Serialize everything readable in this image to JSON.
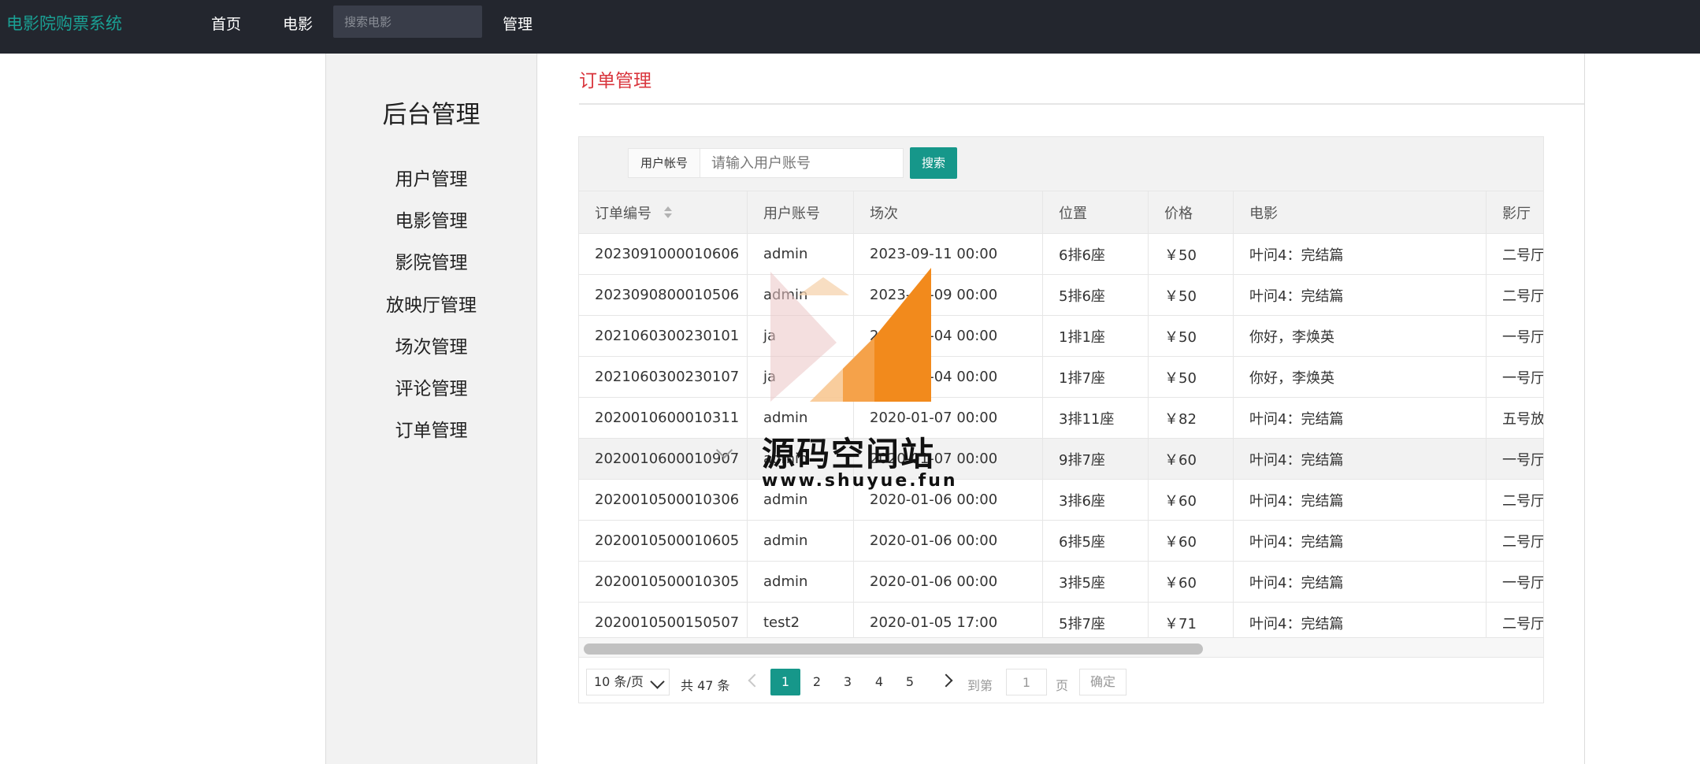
{
  "app": {
    "brand": "电影院购票系统"
  },
  "nav": {
    "home": "首页",
    "movies": "电影",
    "search_placeholder": "搜索电影",
    "admin": "管理"
  },
  "sidebar": {
    "title": "后台管理",
    "items": [
      {
        "label": "用户管理"
      },
      {
        "label": "电影管理"
      },
      {
        "label": "影院管理"
      },
      {
        "label": "放映厅管理"
      },
      {
        "label": "场次管理"
      },
      {
        "label": "评论管理"
      },
      {
        "label": "订单管理"
      }
    ]
  },
  "page": {
    "title": "订单管理"
  },
  "filter": {
    "label": "用户帐号",
    "placeholder": "请输入用户账号",
    "button": "搜索"
  },
  "table": {
    "headers": [
      "订单编号",
      "用户账号",
      "场次",
      "位置",
      "价格",
      "电影",
      "影厅"
    ],
    "rows": [
      [
        "2023091000010606",
        "admin",
        "2023-09-11 00:00",
        "6排6座",
        "￥50",
        "叶问4：完结篇",
        "二号厅"
      ],
      [
        "2023090800010506",
        "admin",
        "2023-09-09 00:00",
        "5排6座",
        "￥50",
        "叶问4：完结篇",
        "二号厅"
      ],
      [
        "2021060300230101",
        "ja",
        "2021-06-04 00:00",
        "1排1座",
        "￥50",
        "你好，李焕英",
        "一号厅"
      ],
      [
        "2021060300230107",
        "ja",
        "2021-06-04 00:00",
        "1排7座",
        "￥50",
        "你好，李焕英",
        "一号厅"
      ],
      [
        "2020010600010311",
        "admin",
        "2020-01-07 00:00",
        "3排11座",
        "￥82",
        "叶问4：完结篇",
        "五号放"
      ],
      [
        "2020010600010907",
        "admin",
        "2020-01-07 00:00",
        "9排7座",
        "￥60",
        "叶问4：完结篇",
        "一号厅"
      ],
      [
        "2020010500010306",
        "admin",
        "2020-01-06 00:00",
        "3排6座",
        "￥60",
        "叶问4：完结篇",
        "二号厅"
      ],
      [
        "2020010500010605",
        "admin",
        "2020-01-06 00:00",
        "6排5座",
        "￥60",
        "叶问4：完结篇",
        "二号厅"
      ],
      [
        "2020010500010305",
        "admin",
        "2020-01-06 00:00",
        "3排5座",
        "￥60",
        "叶问4：完结篇",
        "一号厅"
      ],
      [
        "2020010500150507",
        "test2",
        "2020-01-05 17:00",
        "5排7座",
        "￥71",
        "叶问4：完结篇",
        "二号厅"
      ]
    ]
  },
  "pagination": {
    "page_size": "10 条/页",
    "total": "共 47 条",
    "pages": [
      "1",
      "2",
      "3",
      "4",
      "5"
    ],
    "goto_label": "到第",
    "goto_value": "1",
    "page_unit": "页",
    "confirm": "确定"
  },
  "watermark": {
    "text": "源码空间站",
    "url": "www.shuyue.fun"
  },
  "colors": {
    "accent": "#16978a",
    "title_red": "#d9363e",
    "topbar": "#23262e",
    "watermark_orange": "#f28a1c"
  }
}
